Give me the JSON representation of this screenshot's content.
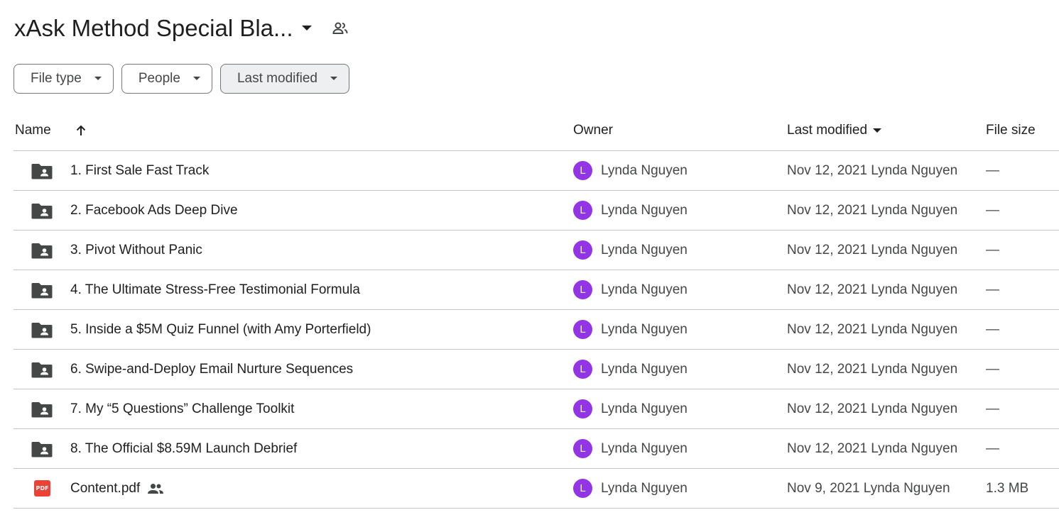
{
  "header": {
    "folder_title": "xAsk Method Special Bla...",
    "caret_icon": "arrow-drop-down-icon",
    "shared_icon": "people-icon"
  },
  "filters": [
    {
      "label": "File type",
      "active": false
    },
    {
      "label": "People",
      "active": false
    },
    {
      "label": "Last modified",
      "active": true
    }
  ],
  "table": {
    "columns": {
      "name": "Name",
      "owner": "Owner",
      "last_modified": "Last modified",
      "file_size": "File size"
    },
    "rows": [
      {
        "type": "shared-folder",
        "name": "1. First Sale Fast Track",
        "owner": "Lynda Nguyen",
        "avatar_letter": "L",
        "modified": "Nov 12, 2021 Lynda Nguyen",
        "size": "—",
        "shared": false
      },
      {
        "type": "shared-folder",
        "name": "2. Facebook Ads Deep Dive",
        "owner": "Lynda Nguyen",
        "avatar_letter": "L",
        "modified": "Nov 12, 2021 Lynda Nguyen",
        "size": "—",
        "shared": false
      },
      {
        "type": "shared-folder",
        "name": "3. Pivot Without Panic",
        "owner": "Lynda Nguyen",
        "avatar_letter": "L",
        "modified": "Nov 12, 2021 Lynda Nguyen",
        "size": "—",
        "shared": false
      },
      {
        "type": "shared-folder",
        "name": "4. The Ultimate Stress-Free Testimonial Formula",
        "owner": "Lynda Nguyen",
        "avatar_letter": "L",
        "modified": "Nov 12, 2021 Lynda Nguyen",
        "size": "—",
        "shared": false
      },
      {
        "type": "shared-folder",
        "name": "5. Inside a $5M Quiz Funnel (with Amy Porterfield)",
        "owner": "Lynda Nguyen",
        "avatar_letter": "L",
        "modified": "Nov 12, 2021 Lynda Nguyen",
        "size": "—",
        "shared": false
      },
      {
        "type": "shared-folder",
        "name": "6. Swipe-and-Deploy Email Nurture Sequences",
        "owner": "Lynda Nguyen",
        "avatar_letter": "L",
        "modified": "Nov 12, 2021 Lynda Nguyen",
        "size": "—",
        "shared": false
      },
      {
        "type": "shared-folder",
        "name": "7. My “5 Questions” Challenge Toolkit",
        "owner": "Lynda Nguyen",
        "avatar_letter": "L",
        "modified": "Nov 12, 2021 Lynda Nguyen",
        "size": "—",
        "shared": false
      },
      {
        "type": "shared-folder",
        "name": "8. The Official $8.59M Launch Debrief",
        "owner": "Lynda Nguyen",
        "avatar_letter": "L",
        "modified": "Nov 12, 2021 Lynda Nguyen",
        "size": "—",
        "shared": false
      },
      {
        "type": "pdf",
        "name": "Content.pdf",
        "owner": "Lynda Nguyen",
        "avatar_letter": "L",
        "modified": "Nov 9, 2021 Lynda Nguyen",
        "size": "1.3 MB",
        "shared": true,
        "pdf_badge": "PDF"
      }
    ]
  },
  "colors": {
    "avatar": "#9334e6",
    "pdf_icon": "#ea4335",
    "folder_icon": "#444746",
    "divider": "#c7c7c7"
  }
}
